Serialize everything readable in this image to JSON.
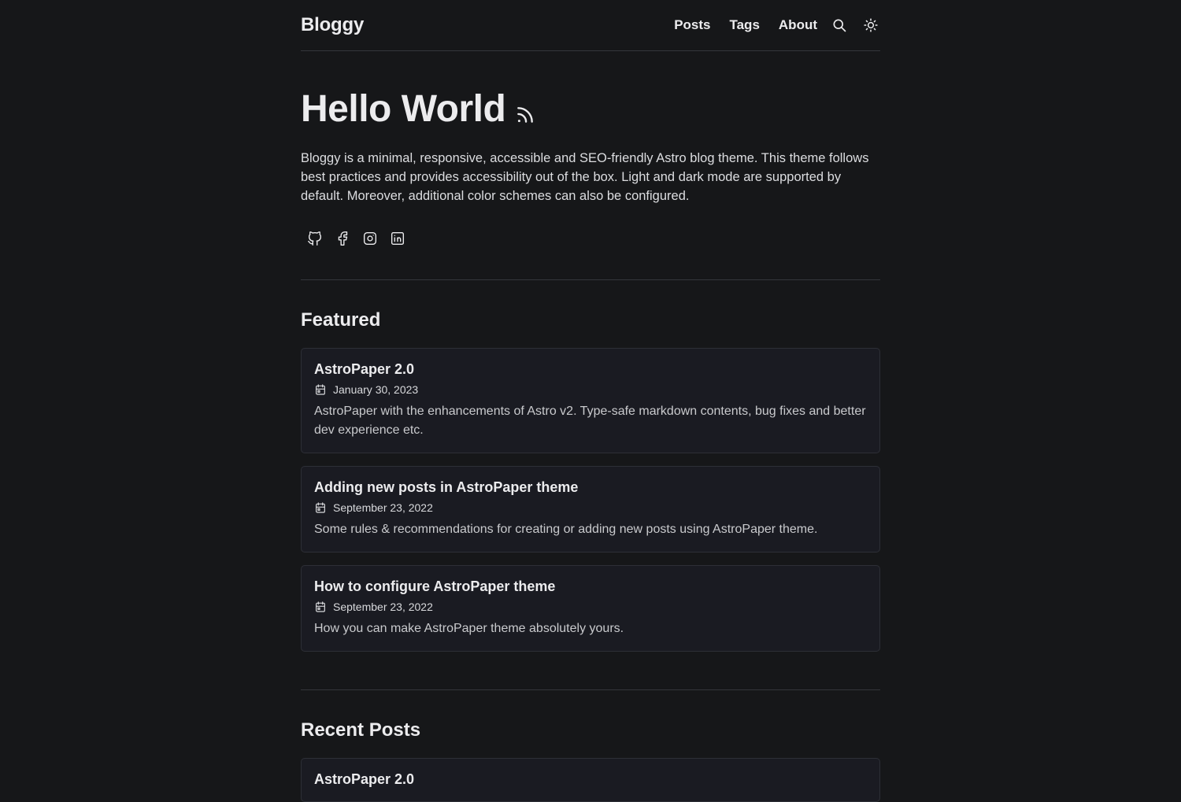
{
  "header": {
    "brand": "Bloggy",
    "nav": [
      "Posts",
      "Tags",
      "About"
    ],
    "icons": [
      "search-icon",
      "sun-icon"
    ]
  },
  "hero": {
    "title": "Hello World",
    "rss_icon": "rss-icon",
    "description": "Bloggy is a minimal, responsive, accessible and SEO-friendly Astro blog theme. This theme follows best practices and provides accessibility out of the box. Light and dark mode are supported by default. Moreover, additional color schemes can also be configured.",
    "socials": [
      "github-icon",
      "facebook-icon",
      "instagram-icon",
      "linkedin-icon"
    ]
  },
  "featured": {
    "heading": "Featured",
    "posts": [
      {
        "title": "AstroPaper 2.0",
        "date": "January 30, 2023",
        "description": "AstroPaper with the enhancements of Astro v2. Type-safe markdown contents, bug fixes and better dev experience etc."
      },
      {
        "title": "Adding new posts in AstroPaper theme",
        "date": "September 23, 2022",
        "description": "Some rules & recommendations for creating or adding new posts using AstroPaper theme."
      },
      {
        "title": "How to configure AstroPaper theme",
        "date": "September 23, 2022",
        "description": "How you can make AstroPaper theme absolutely yours."
      }
    ]
  },
  "recent": {
    "heading": "Recent Posts",
    "posts": [
      {
        "title": "AstroPaper 2.0"
      }
    ]
  },
  "colors": {
    "background": "#161719",
    "card": "#1a1b22",
    "border": "#2d2f36",
    "text": "#ececee"
  }
}
